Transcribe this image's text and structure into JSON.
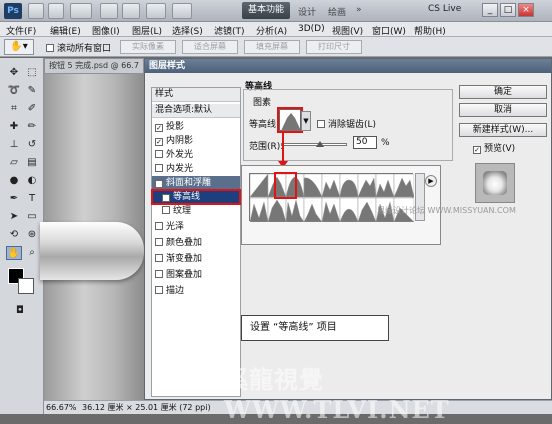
{
  "app": {
    "logo": "Ps",
    "workspace": "基本功能",
    "workspace_links": [
      "设计",
      "绘画"
    ],
    "cslive": "CS Live",
    "window_controls": [
      "_",
      "□",
      "×"
    ]
  },
  "menu": [
    "文件(F)",
    "编辑(E)",
    "图像(I)",
    "图层(L)",
    "选择(S)",
    "滤镜(T)",
    "分析(A)",
    "3D(D)",
    "视图(V)",
    "窗口(W)",
    "帮助(H)"
  ],
  "options": {
    "scroll_all": "滚动所有窗口",
    "buttons": [
      "实际像素",
      "适合屏幕",
      "填充屏幕",
      "打印尺寸"
    ]
  },
  "document": {
    "tab": "按钮 5 完成.psd @ 66.7",
    "zoom": "66.67%",
    "size": "36.12 厘米 × 25.01 厘米 (72 ppi)"
  },
  "dialog": {
    "title": "图层样式",
    "styles_header": "样式",
    "blend_header": "混合选项:默认",
    "items": [
      {
        "label": "投影",
        "checked": true
      },
      {
        "label": "内阴影",
        "checked": true
      },
      {
        "label": "外发光",
        "checked": false
      },
      {
        "label": "内发光",
        "checked": false
      },
      {
        "label": "斜面和浮雕",
        "checked": true,
        "selected": true
      },
      {
        "label": "等高线",
        "checked": true,
        "active": true
      },
      {
        "label": "纹理",
        "checked": false
      },
      {
        "label": "光泽",
        "checked": false
      },
      {
        "label": "颜色叠加",
        "checked": false
      },
      {
        "label": "渐变叠加",
        "checked": false
      },
      {
        "label": "图案叠加",
        "checked": false
      },
      {
        "label": "描边",
        "checked": false
      }
    ],
    "section_title": "等高线",
    "group_title": "图素",
    "contour_label": "等高线:",
    "antialias_label": "消除锯齿(L)",
    "range_label": "范围(R):",
    "range_value": "50",
    "range_unit": "%",
    "range_fraction": 0.5,
    "buttons": {
      "ok": "确定",
      "cancel": "取消",
      "new_style": "新建样式(W)...",
      "preview": "预览(V)"
    },
    "callout": "设置 “等高线” 项目"
  },
  "watermarks": {
    "site": "思缘设计论坛  WWW.MISSYUAN.COM",
    "bottom": "溪龍視覺 WWW.TLVI.NET"
  },
  "colors": {
    "highlight": "#e01414",
    "selected_row": "#5a6f8c",
    "active_row": "#1d3f7e"
  }
}
